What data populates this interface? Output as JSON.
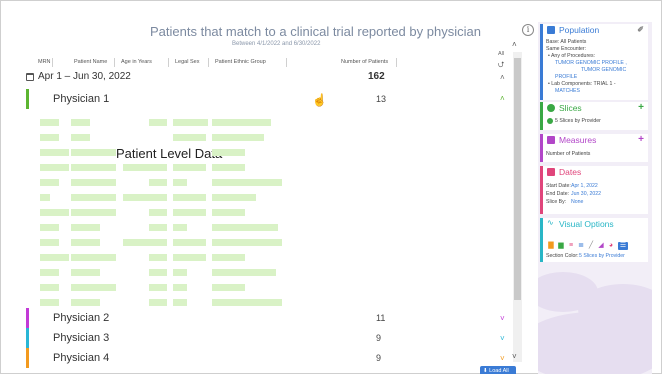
{
  "report": {
    "title": "Patients that match to a clinical trial reported by physician",
    "subtitle": "Between 4/1/2022 and 6/30/2022",
    "columns": [
      "MRN",
      "Patient Name",
      "Age in Years",
      "Legal Sex",
      "Patient Ethnic Group",
      "Number of Patients"
    ],
    "all_label": "All",
    "date_group": {
      "label": "Apr 1 – Jun 30, 2022",
      "total": "162"
    },
    "physicians": [
      {
        "name": "Physician 1",
        "count": "13",
        "color": "#5cb531",
        "expanded": true
      },
      {
        "name": "Physician 2",
        "count": "11",
        "color": "#c23ad6",
        "expanded": false
      },
      {
        "name": "Physician 3",
        "count": "9",
        "color": "#29b6d6",
        "expanded": false
      },
      {
        "name": "Physician 4",
        "count": "9",
        "color": "#f39a1e",
        "expanded": false
      }
    ],
    "patient_level_label": "Patient Level Data",
    "placeholder_color": "#d9f2c6",
    "load_all_label": "⬇ Load All"
  },
  "panel": {
    "population": {
      "title": "Population",
      "color": "#3a7bd5",
      "lines": [
        "Base: All Patients",
        "Same Encounter:",
        "• Any of Procedures:",
        "TUMOR GENOMIC PROFILE ,",
        "TUMOR GENOMIC",
        "PROFILE",
        "• Lab Components: TRIAL 1 -",
        "MATCHES"
      ]
    },
    "slices": {
      "title": "Slices",
      "color": "#3aa845",
      "item": "5 Slices by Provider"
    },
    "measures": {
      "title": "Measures",
      "color": "#b246c8",
      "item": "Number of Patients"
    },
    "dates": {
      "title": "Dates",
      "color": "#e0457b",
      "start_label": "Start Date:",
      "start_value": "Apr 1, 2022",
      "end_label": "End Date:",
      "end_value": "Jun 30, 2022",
      "slice_label": "Slice By:",
      "slice_value": "None"
    },
    "visual_options": {
      "title": "Visual Options",
      "color": "#29b6c6",
      "section_color_label": "Section Color:",
      "section_color_value": "5 Slices by Provider",
      "icons": [
        "bar-chart-icon",
        "stacked-bar-icon",
        "horizontal-bar-icon",
        "stacked-horizontal-bar-icon",
        "line-chart-icon",
        "area-chart-icon",
        "pie-chart-icon",
        "table-icon"
      ]
    }
  }
}
